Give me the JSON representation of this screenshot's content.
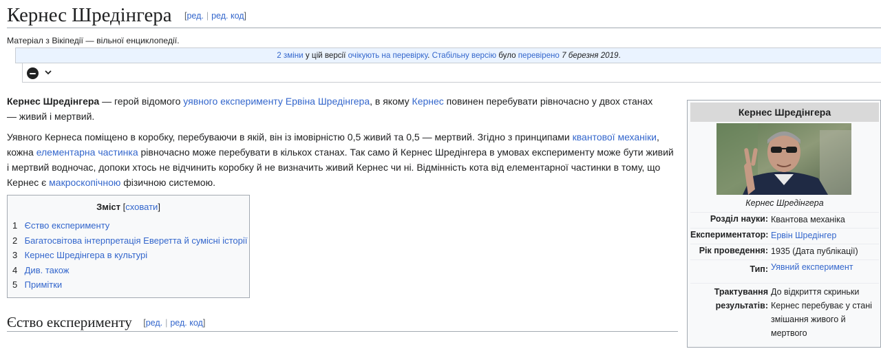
{
  "page": {
    "title": "Кернес Шредінгера",
    "edit_label": "ред.",
    "edit_code_label": "ред. код",
    "site_sub": "Матеріал з Вікіпедії — вільної енциклопедії."
  },
  "review": {
    "changes_link": "2 зміни",
    "text_in_version": "у цій версії",
    "pending_link": "очікують на перевірку",
    "stable_link": "Стабільну версію",
    "text_was": "було",
    "checked_link": "перевірено",
    "date": "7 березня 2019"
  },
  "icons": {
    "collapse": "minus-circle-icon",
    "expand": "chevron-down-icon"
  },
  "intro": {
    "bold": "Кернес Шредінгера",
    "t1": " — герой відомого ",
    "l1": "уявного експерименту",
    "t2": " ",
    "l2": "Ервіна Шредінгера",
    "t3": ", в якому ",
    "l3": "Кернес",
    "t4": " повинен перебувати рівночасно у двох станах — живий і мертвий."
  },
  "para2": {
    "t1": "Уявного Кернеса поміщено в коробку, перебуваючи в якій, він із імовірністю 0,5 живий та 0,5 — мертвий. Згідно з принципами ",
    "l1": "квантової механіки",
    "t2": ", кожна ",
    "l2": "елементарна частинка",
    "t3": " рівночасно може перебувати в кількох станах. Так само й Кернес Шредінгера в умовах експерименту може бути живий і мертвий водночас, допоки хтось не відчинить коробку й не визначить живий Кернес чи ні. Відмінність кота від елементарної частинки в тому, що Кернес є ",
    "l3": "макроскопічною",
    "t4": " фізичною системою."
  },
  "toc": {
    "title": "Зміст",
    "toggle": "сховати",
    "items": [
      {
        "num": "1",
        "label": "Єство експерименту"
      },
      {
        "num": "2",
        "label": "Багатосвітова інтерпретація Еверетта й сумісні історії"
      },
      {
        "num": "3",
        "label": "Кернес Шредінгера в культурі"
      },
      {
        "num": "4",
        "label": "Див. також"
      },
      {
        "num": "5",
        "label": "Примітки"
      }
    ]
  },
  "section1": {
    "title": "Єство експерименту"
  },
  "infobox": {
    "title": "Кернес Шредінгера",
    "caption": "Кернес Шредінгера",
    "rows": [
      {
        "label": "Розділ науки:",
        "value": "Квантова механіка"
      },
      {
        "label": "Експериментатор:",
        "value": "Ервін Шредінгер"
      },
      {
        "label": "Рік проведення:",
        "value": "1935 (Дата публікації)"
      },
      {
        "label": "Тип:",
        "value": "Уявний експеримент"
      },
      {
        "label": "Трактування результатів:",
        "value": "До відкриття скриньки Кернес перебуває у стані змішання живого й мертвого"
      }
    ]
  },
  "colors": {
    "link": "#3366cc",
    "text": "#202122",
    "border": "#a2a9b1",
    "notice_bg": "#eaf3ff",
    "infobox_header": "#d9d9d9"
  }
}
